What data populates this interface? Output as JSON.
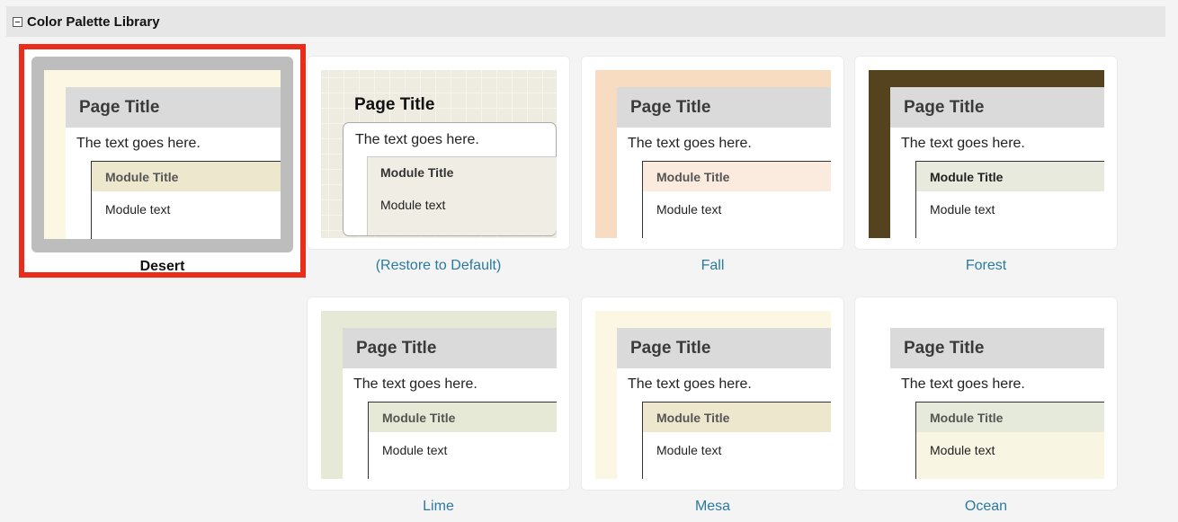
{
  "header": {
    "title": "Color Palette Library"
  },
  "preview_text": {
    "page_title": "Page Title",
    "body_text": "The text goes here.",
    "module_title": "Module Title",
    "module_text": "Module text"
  },
  "palettes": [
    {
      "id": "desert",
      "label": "Desert",
      "selected": true,
      "colors": {
        "background": "#fbf7e2",
        "module_title_bg": "#ece7cd"
      }
    },
    {
      "id": "default",
      "label": "(Restore to Default)",
      "selected": false,
      "colors": {
        "background": "#eeebe0",
        "module_bg": "#efede4"
      }
    },
    {
      "id": "fall",
      "label": "Fall",
      "selected": false,
      "colors": {
        "background": "#f8dcc2",
        "module_title_bg": "#fbebde"
      }
    },
    {
      "id": "forest",
      "label": "Forest",
      "selected": false,
      "colors": {
        "background": "#55421f",
        "module_title_bg": "#e7eadc"
      }
    },
    {
      "id": "lime",
      "label": "Lime",
      "selected": false,
      "colors": {
        "background": "#e6e9d6",
        "module_title_bg": "#e6e9d6"
      }
    },
    {
      "id": "mesa",
      "label": "Mesa",
      "selected": false,
      "colors": {
        "background": "#fbf7e2",
        "module_title_bg": "#ece7cd"
      }
    },
    {
      "id": "ocean",
      "label": "Ocean",
      "selected": false,
      "colors": {
        "background": "#ffffff",
        "module_title_bg": "#e6eadb",
        "module_bg": "#f8f6e3"
      }
    }
  ]
}
